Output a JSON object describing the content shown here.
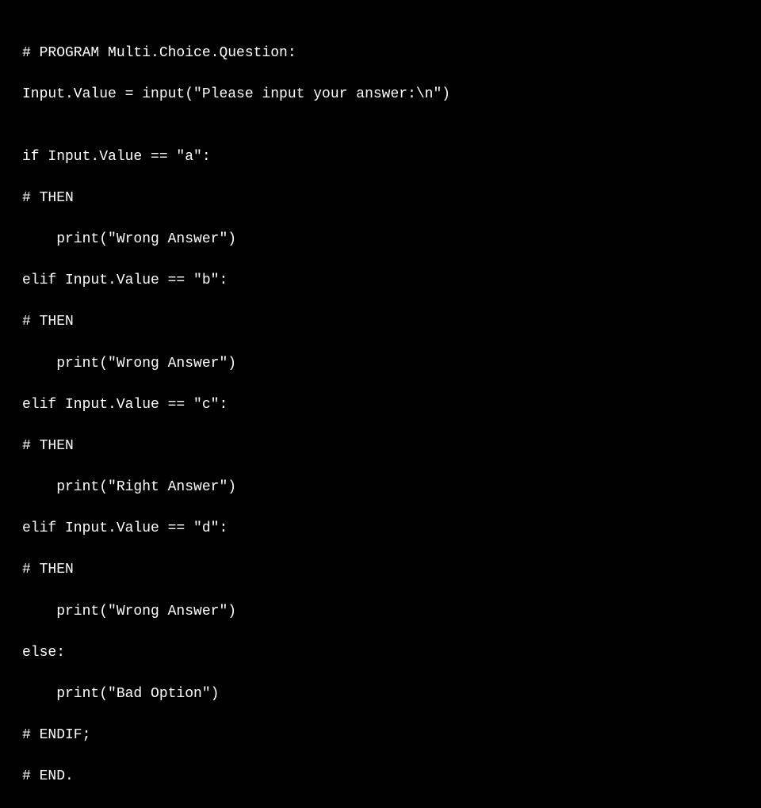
{
  "code": {
    "line1": "# PROGRAM Multi.Choice.Question:",
    "line2": "Input.Value = input(\"Please input your answer:\\n\")",
    "line3": "",
    "line4": "if Input.Value == \"a\":",
    "line5": "# THEN",
    "line6": "    print(\"Wrong Answer\")",
    "line7": "elif Input.Value == \"b\":",
    "line8": "# THEN",
    "line9": "    print(\"Wrong Answer\")",
    "line10": "elif Input.Value == \"c\":",
    "line11": "# THEN",
    "line12": "    print(\"Right Answer\")",
    "line13": "elif Input.Value == \"d\":",
    "line14": "# THEN",
    "line15": "    print(\"Wrong Answer\")",
    "line16": "else:",
    "line17": "    print(\"Bad Option\")",
    "line18": "# ENDIF;",
    "line19": "# END."
  }
}
